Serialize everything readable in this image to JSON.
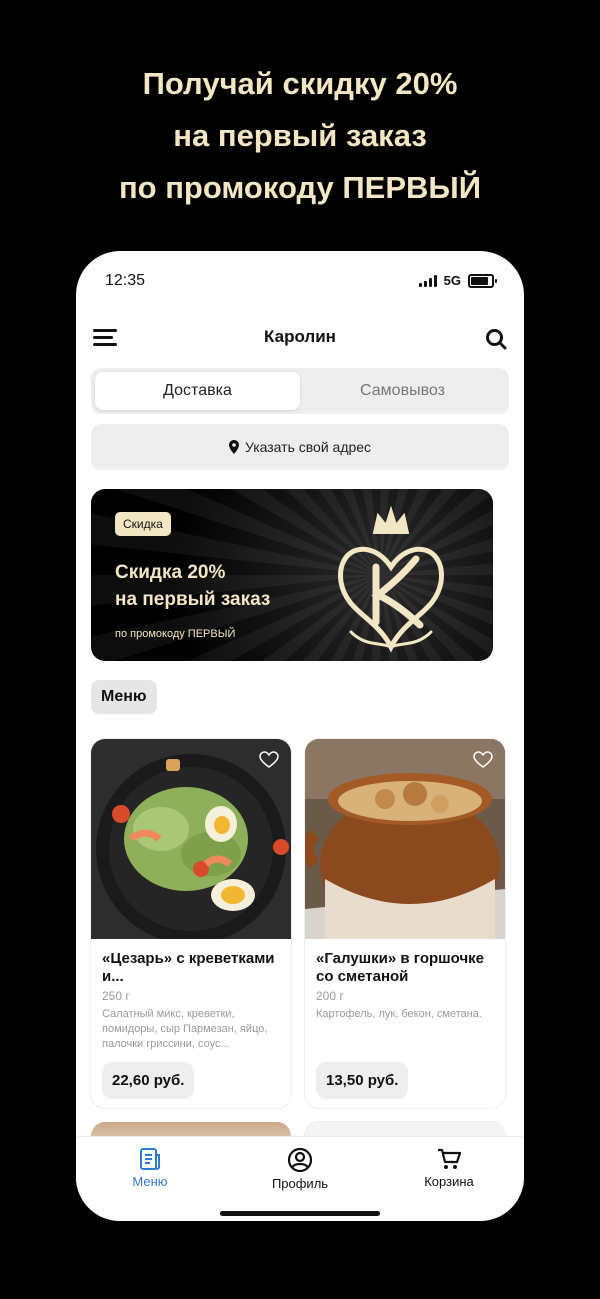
{
  "promo_headline": [
    "Получай скидку 20%",
    "на первый заказ",
    "по промокоду ПЕРВЫЙ"
  ],
  "status_bar": {
    "time": "12:35",
    "network": "5G"
  },
  "header": {
    "title": "Каролин",
    "menu_icon": "hamburger-icon",
    "search_icon": "search-icon"
  },
  "delivery_tabs": {
    "delivery": "Доставка",
    "pickup": "Самовывоз",
    "selected": "delivery"
  },
  "address": {
    "label": "Указать свой адрес",
    "icon": "location-pin-icon"
  },
  "banner": {
    "tag": "Скидка",
    "title_line1": "Скидка 20%",
    "title_line2": "на первый заказ",
    "subtitle": "по промокоду ПЕРВЫЙ",
    "logo": "crown-monogram-logo",
    "accent_color": "#f3e6c4"
  },
  "section": {
    "label": "Меню"
  },
  "products": [
    {
      "name": "«Цезарь» с креветками и...",
      "weight": "250 г",
      "description": "Салатный микс, креветки, помидоры, сыр Пармезан, яйцо, палочки гриссини, соус...",
      "price": "22,60 руб.",
      "favorite_icon": "heart-outline-icon"
    },
    {
      "name": "«Галушки» в горшочке со сметаной",
      "weight": "200 г",
      "description": "Картофель, лук, бекон, сметана.",
      "price": "13,50 руб.",
      "favorite_icon": "heart-outline-icon"
    }
  ],
  "bottom_nav": {
    "items": [
      {
        "label": "Меню",
        "icon": "menu-doc-icon",
        "active": true
      },
      {
        "label": "Профиль",
        "icon": "profile-icon",
        "active": false
      },
      {
        "label": "Корзина",
        "icon": "cart-icon",
        "active": false
      }
    ],
    "active_color": "#2f7ad6"
  }
}
